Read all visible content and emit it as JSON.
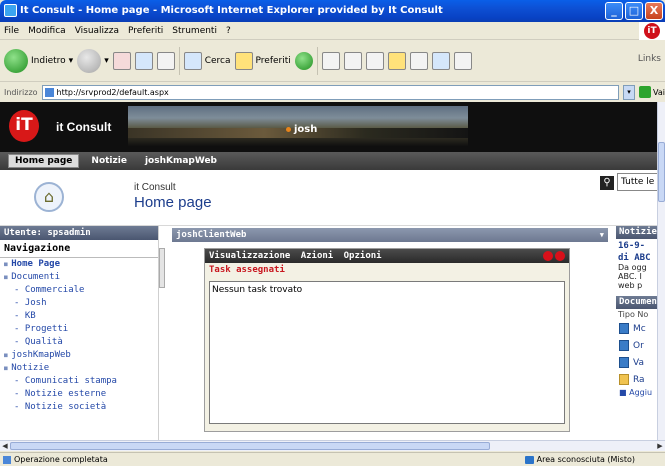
{
  "window": {
    "title": "It Consult - Home page - Microsoft Internet Explorer provided by It Consult",
    "minimize": "_",
    "maximize": "□",
    "close": "X"
  },
  "menubar": {
    "items": [
      "File",
      "Modifica",
      "Visualizza",
      "Preferiti",
      "Strumenti",
      "?"
    ],
    "logo": "iT"
  },
  "toolbar": {
    "back": "Indietro",
    "search": "Cerca",
    "favorites": "Preferiti",
    "links": "Links"
  },
  "address": {
    "label": "Indirizzo",
    "url": "http://srvprod2/default.aspx",
    "go": "Vai"
  },
  "banner": {
    "logo": "iT",
    "brand": "it Consult",
    "user": "josh"
  },
  "nav": {
    "tabs": [
      "Home page",
      "Notizie",
      "joshKmapWeb"
    ]
  },
  "header": {
    "site_name": "it Consult",
    "page_title": "Home page",
    "search_scope": "Tutte le origini"
  },
  "leftnav": {
    "user": "Utente: spsadmin",
    "heading": "Navigazione",
    "items": [
      {
        "label": "Home Page",
        "level": "top",
        "bold": true
      },
      {
        "label": "Documenti",
        "level": "top"
      },
      {
        "label": "Commerciale",
        "level": "sub"
      },
      {
        "label": "Josh",
        "level": "sub"
      },
      {
        "label": "KB",
        "level": "sub"
      },
      {
        "label": "Progetti",
        "level": "sub"
      },
      {
        "label": "Qualità",
        "level": "sub"
      },
      {
        "label": "joshKmapWeb",
        "level": "top"
      },
      {
        "label": "Notizie",
        "level": "top"
      },
      {
        "label": "Comunicati stampa",
        "level": "sub"
      },
      {
        "label": "Notizie esterne",
        "level": "sub"
      },
      {
        "label": "Notizie società",
        "level": "sub"
      }
    ]
  },
  "webpart": {
    "title": "joshClientWeb",
    "menu": [
      "Visualizzazione",
      "Azioni",
      "Opzioni"
    ],
    "tasks_heading": "Task assegnati",
    "empty_message": "Nessun task trovato"
  },
  "rightcol": {
    "news_bar": "Notizie",
    "news_title_1": "16-9-",
    "news_title_2": "di ABC",
    "news_text": [
      "Da ogg",
      "ABC. I",
      "web p"
    ],
    "docs_bar": "Documenti",
    "docs_col": "Tipo No",
    "docs": [
      {
        "label": "Mc",
        "icon": "doc"
      },
      {
        "label": "Or",
        "icon": "doc"
      },
      {
        "label": "Va",
        "icon": "doc"
      },
      {
        "label": "Ra",
        "icon": "folder"
      }
    ],
    "add": "■ Aggiu"
  },
  "status": {
    "text": "Operazione completata",
    "zone": "Area sconosciuta (Misto)"
  }
}
